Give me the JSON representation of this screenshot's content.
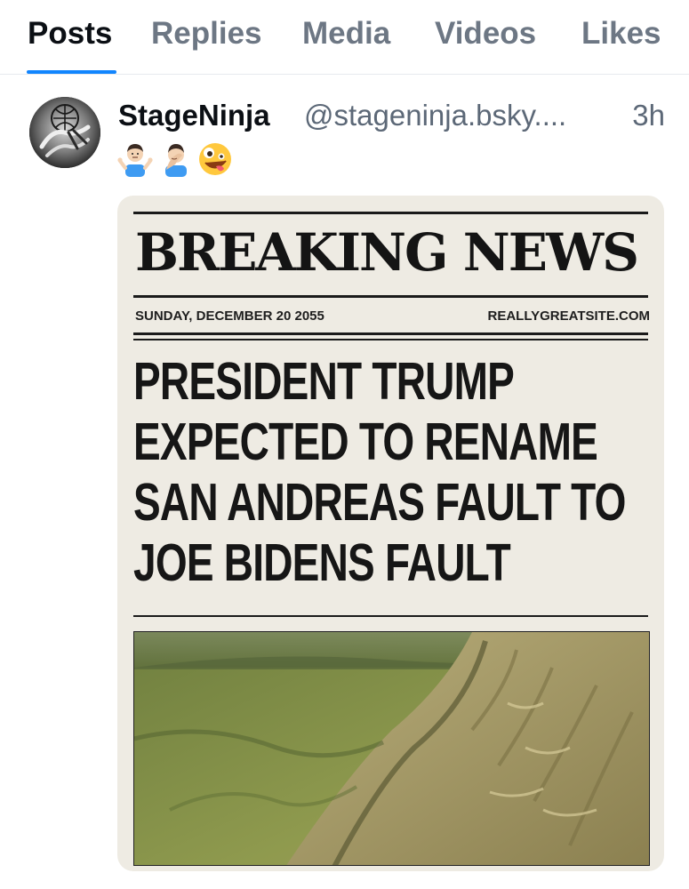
{
  "tabs": [
    {
      "label": "Posts",
      "active": true
    },
    {
      "label": "Replies",
      "active": false
    },
    {
      "label": "Media",
      "active": false
    },
    {
      "label": "Videos",
      "active": false
    },
    {
      "label": "Likes",
      "active": false
    }
  ],
  "post": {
    "display_name": "StageNinja",
    "handle": "@stageninja.bsky....",
    "timestamp": "3h",
    "emojis": [
      "person-shrugging",
      "person-facepalming",
      "zany-face"
    ],
    "image": {
      "masthead": "BREAKING NEWS",
      "date": "SUNDAY, DECEMBER 20 2055",
      "site": "REALLYGREATSITE.COM",
      "headline_lines": [
        "PRESIDENT TRUMP",
        "EXPECTED TO RENAME",
        "SAN ANDREAS FAULT TO",
        "JOE BIDENS FAULT"
      ],
      "photo": "aerial-fault-landscape"
    }
  },
  "colors": {
    "accent": "#1185fe",
    "text_primary": "#0b0f14",
    "text_secondary": "#5c6877",
    "tab_inactive": "#6d7784",
    "paper": "#eeebe3"
  }
}
